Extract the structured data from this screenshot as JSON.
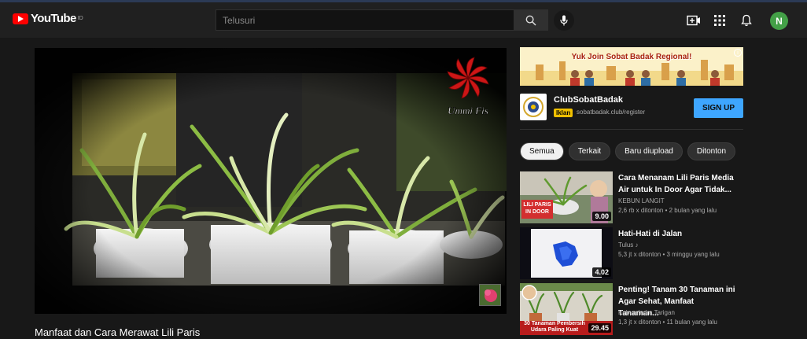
{
  "app": {
    "logo_text": "YouTube",
    "region": "ID"
  },
  "search": {
    "placeholder": "Telusuri"
  },
  "header": {
    "icons": [
      "create-icon",
      "apps-icon",
      "notifications-icon"
    ],
    "avatar_letter": "N"
  },
  "player": {
    "watermark": "Ummi Fis",
    "title": "Manfaat dan Cara Merawat Lili Paris"
  },
  "ad": {
    "banner_text": "Yuk Join Sobat Badak Regional!",
    "advertiser": "ClubSobatBadak",
    "badge": "Iklan",
    "url": "sobatbadak.club/register",
    "cta": "SIGN UP"
  },
  "chips": [
    "Semua",
    "Terkait",
    "Baru diupload",
    "Ditonton"
  ],
  "recommendations": [
    {
      "title": "Cara Menanam Lili Paris Media Air untuk In Door Agar Tidak...",
      "channel": "KEBUN LANGIT",
      "meta": "2,6 rb x ditonton • 2 bulan yang lalu",
      "duration": "9.00",
      "thumb_caption": "LILI PARIS IN DOOR"
    },
    {
      "title": "Hati-Hati di Jalan",
      "channel": "Tulus ♪",
      "meta": "5,3 jt x ditonton • 3 minggu yang lalu",
      "duration": "4.02",
      "thumb_caption": ""
    },
    {
      "title": "Penting! Tanam 30 Tanaman ini Agar Sehat, Manfaat Tanaman...",
      "channel": "Kebun Indra Tarigan",
      "meta": "1,3 jt x ditonton • 11 bulan yang lalu",
      "duration": "29.45",
      "thumb_caption": "30 Tanaman Pembersih Udara Paling Kuat"
    }
  ],
  "colors": {
    "background": "#181818",
    "header": "#202020",
    "brand_red": "#ff0000",
    "signup_blue": "#3ea6ff",
    "avatar_green": "#43a047",
    "ad_badge": "#f0c000"
  }
}
